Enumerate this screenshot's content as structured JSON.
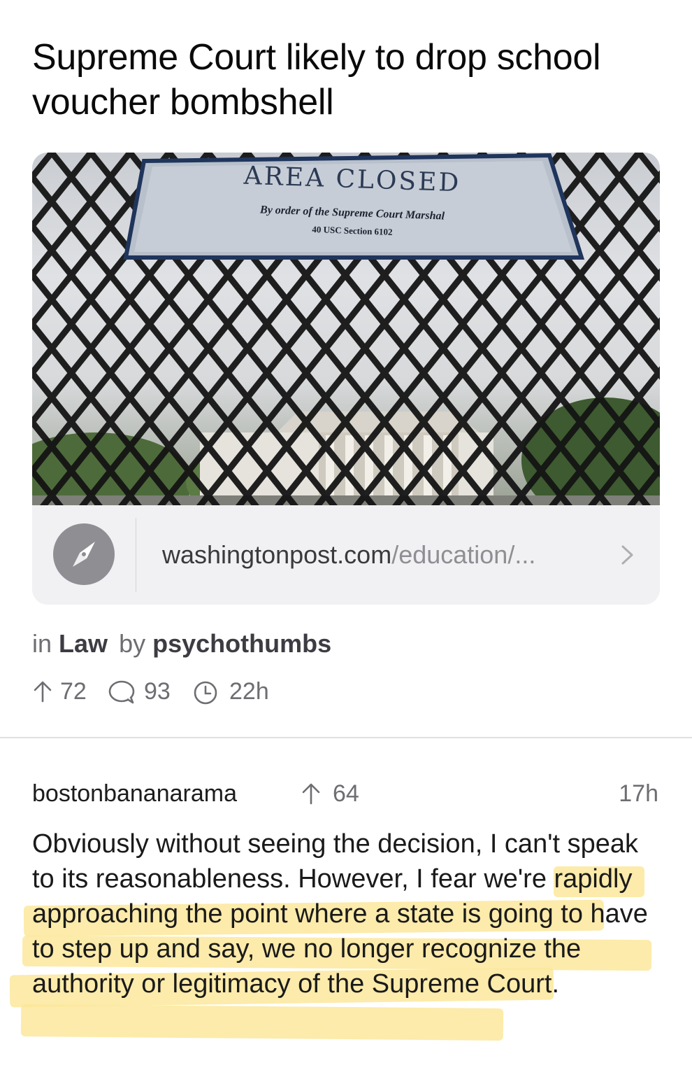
{
  "post": {
    "title": "Supreme Court likely to drop school voucher bombshell",
    "image": {
      "sign_title": "AREA CLOSED",
      "sign_subtitle": "By order of the Supreme Court Marshal",
      "sign_citation": "40 USC Section 6102"
    },
    "link": {
      "domain": "washingtonpost.com",
      "path": "/education/...",
      "icon": "compass-icon"
    },
    "meta": {
      "in_label": "in",
      "community": "Law",
      "by_label": "by",
      "author": "psychothumbs"
    },
    "stats": {
      "upvotes": "72",
      "comments": "93",
      "age": "22h"
    }
  },
  "comment": {
    "author": "bostonbananarama",
    "score": "64",
    "time": "17h",
    "body": "Obviously without seeing the decision, I can't speak to its reasonableness.  However, I fear we're rapidly approaching the point where a state is going to have to step up and say, we no longer recognize the authority or legitimacy of the Supreme Court."
  },
  "colors": {
    "text": "#111111",
    "secondary": "#6d6d72",
    "link_bar_bg": "#f1f1f4",
    "highlight": "#fbe79b"
  }
}
